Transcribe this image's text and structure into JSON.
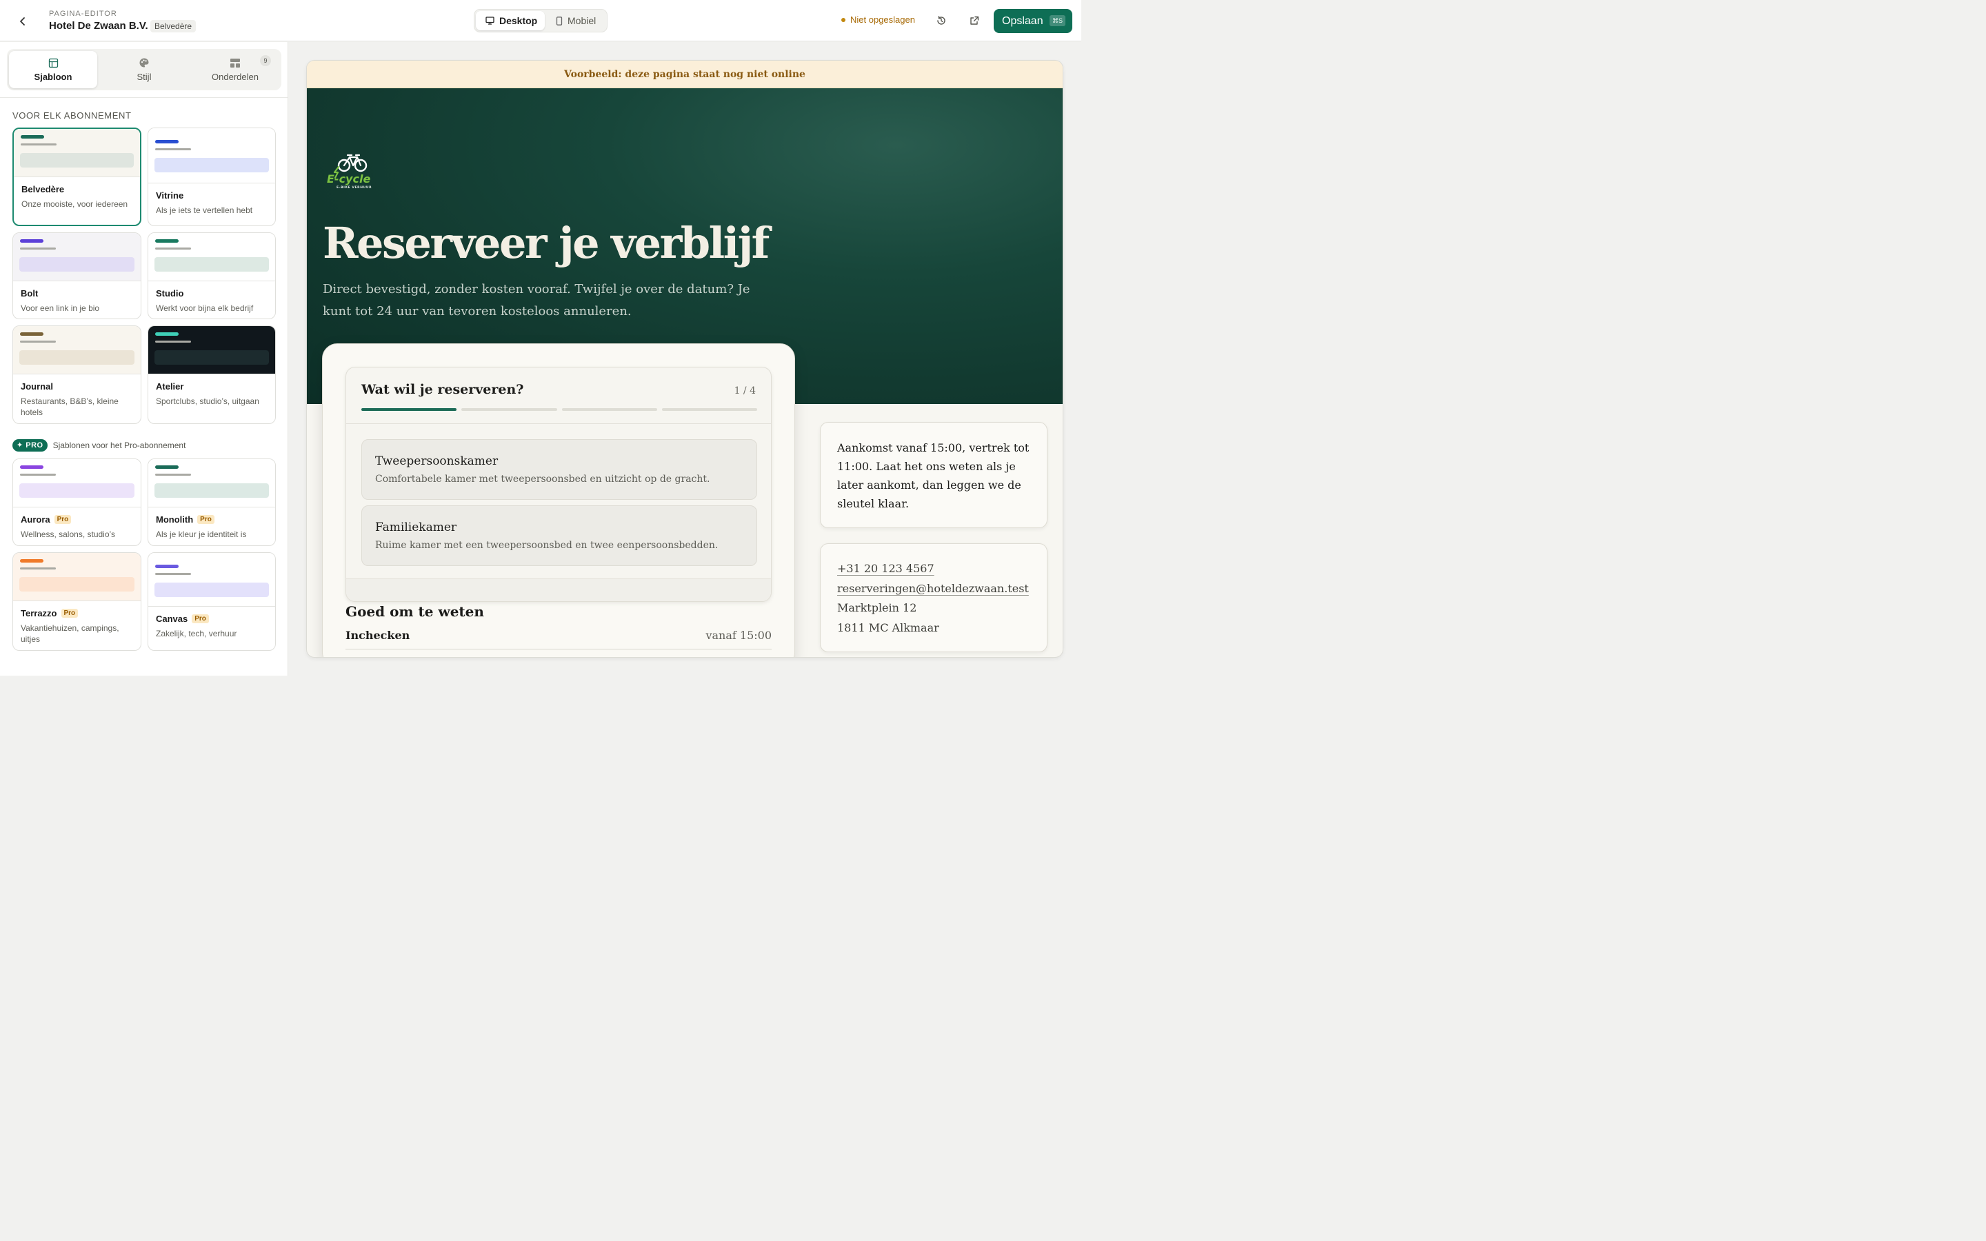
{
  "header": {
    "crumb_small": "PAGINA-EDITOR",
    "title": "Hotel De Zwaan B.V.",
    "badge": "Belvedère",
    "device_desktop": "Desktop",
    "device_mobile": "Mobiel",
    "unsaved": "Niet opgeslagen",
    "save": "Opslaan",
    "save_kbd": "⌘S"
  },
  "sidebar": {
    "tabs": [
      {
        "label": "Sjabloon",
        "icon": "layout-icon",
        "active": true
      },
      {
        "label": "Stijl",
        "icon": "palette-icon"
      },
      {
        "label": "Onderdelen",
        "icon": "blocks-icon",
        "count": "9"
      }
    ],
    "section_title": "VOOR ELK ABONNEMENT",
    "pro_badge": "PRO",
    "pro_text": "Sjablonen voor het Pro-abonnement",
    "pro_label": "Pro",
    "templates": [
      {
        "name": "Belvedère",
        "desc": "Onze mooiste, voor iedereen",
        "accent": "#1a6b58",
        "block": "#dfe5df",
        "bg": "#f7f5ef"
      },
      {
        "name": "Vitrine",
        "desc": "Als je iets te vertellen hebt",
        "accent": "#2a4fd1",
        "block": "#dde2fa",
        "bg": "#ffffff"
      },
      {
        "name": "Bolt",
        "desc": "Voor een link in je bio",
        "accent": "#5b3fd8",
        "block": "#e2ddf5",
        "bg": "#f4f3f6"
      },
      {
        "name": "Studio",
        "desc": "Werkt voor bijna elk bedrijf",
        "accent": "#1a7a60",
        "block": "#dde9e3",
        "bg": "#ffffff"
      },
      {
        "name": "Journal",
        "desc": "Restaurants, B&B’s, kleine hotels",
        "accent": "#7a6338",
        "block": "#ebe4d6",
        "bg": "#f8f5ee"
      },
      {
        "name": "Atelier",
        "desc": "Sportclubs, studio’s, uitgaan",
        "accent": "#3fd0b8",
        "block": "#1c2b2e",
        "bg": "#10171c"
      },
      {
        "name": "Aurora",
        "desc": "Wellness, salons, studio’s",
        "accent": "#8a45e0",
        "block": "#ece3fa",
        "bg": "#ffffff"
      },
      {
        "name": "Monolith",
        "desc": "Als je kleur je identiteit is",
        "accent": "#1a6b58",
        "block": "#dce9e4",
        "bg": "#ffffff"
      },
      {
        "name": "Terrazzo",
        "desc": "Vakantiehuizen, campings, uitjes",
        "accent": "#f07a2a",
        "block": "#fde3d0",
        "bg": "#fdf3ea"
      },
      {
        "name": "Canvas",
        "desc": "Zakelijk, tech, verhuur",
        "accent": "#6a5ae0",
        "block": "#e3e1fb",
        "bg": "#ffffff"
      }
    ]
  },
  "preview": {
    "banner": "Voorbeeld: deze pagina staat nog niet online",
    "logo_text": "E-cycle",
    "logo_sub": "E-BIKE VERHUUR",
    "hero_title": "Reserveer je verblijf",
    "hero_sub": "Direct bevestigd, zonder kosten vooraf. Twijfel je over de datum? Je kunt tot 24 uur van tevoren kosteloos annuleren.",
    "question": "Wat wil je reserveren?",
    "step": "1 / 4",
    "progress": {
      "current": 1,
      "total": 4
    },
    "options": [
      {
        "title": "Tweepersoonskamer",
        "desc": "Comfortabele kamer met tweepersoonsbed en uitzicht op de gracht."
      },
      {
        "title": "Familiekamer",
        "desc": "Ruime kamer met een tweepersoonsbed en twee eenpersoonsbedden."
      }
    ],
    "good_to_know": "Goed om te weten",
    "checkin_label": "Inchecken",
    "checkin_value": "vanaf 15:00",
    "info_text": "Aankomst vanaf 15:00, vertrek tot 11:00. Laat het ons weten als je later aankomt, dan leggen we de sleutel klaar.",
    "contact": {
      "phone": "+31 20 123 4567",
      "email": "reserveringen@hoteldezwaan.test",
      "street": "Marktplein 12",
      "city": "1811 MC Alkmaar"
    }
  },
  "colors": {
    "brand": "#0e6e55",
    "warning": "#a86b08",
    "hero_bg": "#123a30"
  }
}
